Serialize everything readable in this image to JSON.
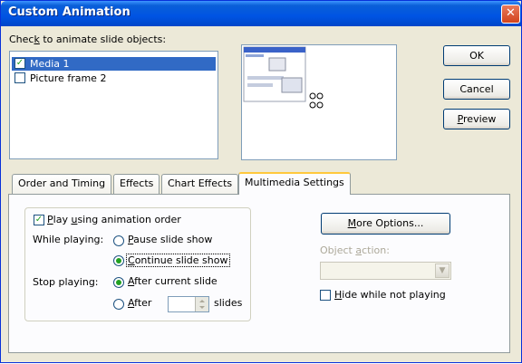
{
  "window": {
    "title": "Custom Animation",
    "close_glyph": "✕"
  },
  "objects": {
    "label": "Check to animate slide objects:",
    "items": [
      {
        "label": "Media 1",
        "checked": true,
        "selected": true
      },
      {
        "label": "Picture frame 2",
        "checked": false,
        "selected": false
      }
    ]
  },
  "buttons": {
    "ok": "OK",
    "cancel": "Cancel",
    "preview": "Preview"
  },
  "tabs": [
    "Order and Timing",
    "Effects",
    "Chart Effects",
    "Multimedia Settings"
  ],
  "active_tab": "Multimedia Settings",
  "multimedia": {
    "play_using_order": "Play using animation order",
    "while_playing_label": "While playing:",
    "pause_slide_show": "Pause slide show",
    "continue_slide_show": "Continue slide show",
    "stop_playing_label": "Stop playing:",
    "after_current_slide": "After current slide",
    "after": "After",
    "slides": "slides",
    "more_options": "More Options...",
    "object_action_label": "Object action:",
    "object_action_value": "",
    "hide_while_not_playing": "Hide while not playing"
  },
  "state": {
    "play_using_order_checked": true,
    "while_playing": "continue",
    "stop_playing": "after_current",
    "hide_checked": false
  },
  "icons": {
    "check": "check-icon",
    "dropdown": "dropdown-arrow-icon"
  },
  "colors": {
    "title_bar": "#0054e3",
    "selection": "#316ac5",
    "active_tab_accent": "#ffc83c",
    "close_button": "#d3441c"
  }
}
